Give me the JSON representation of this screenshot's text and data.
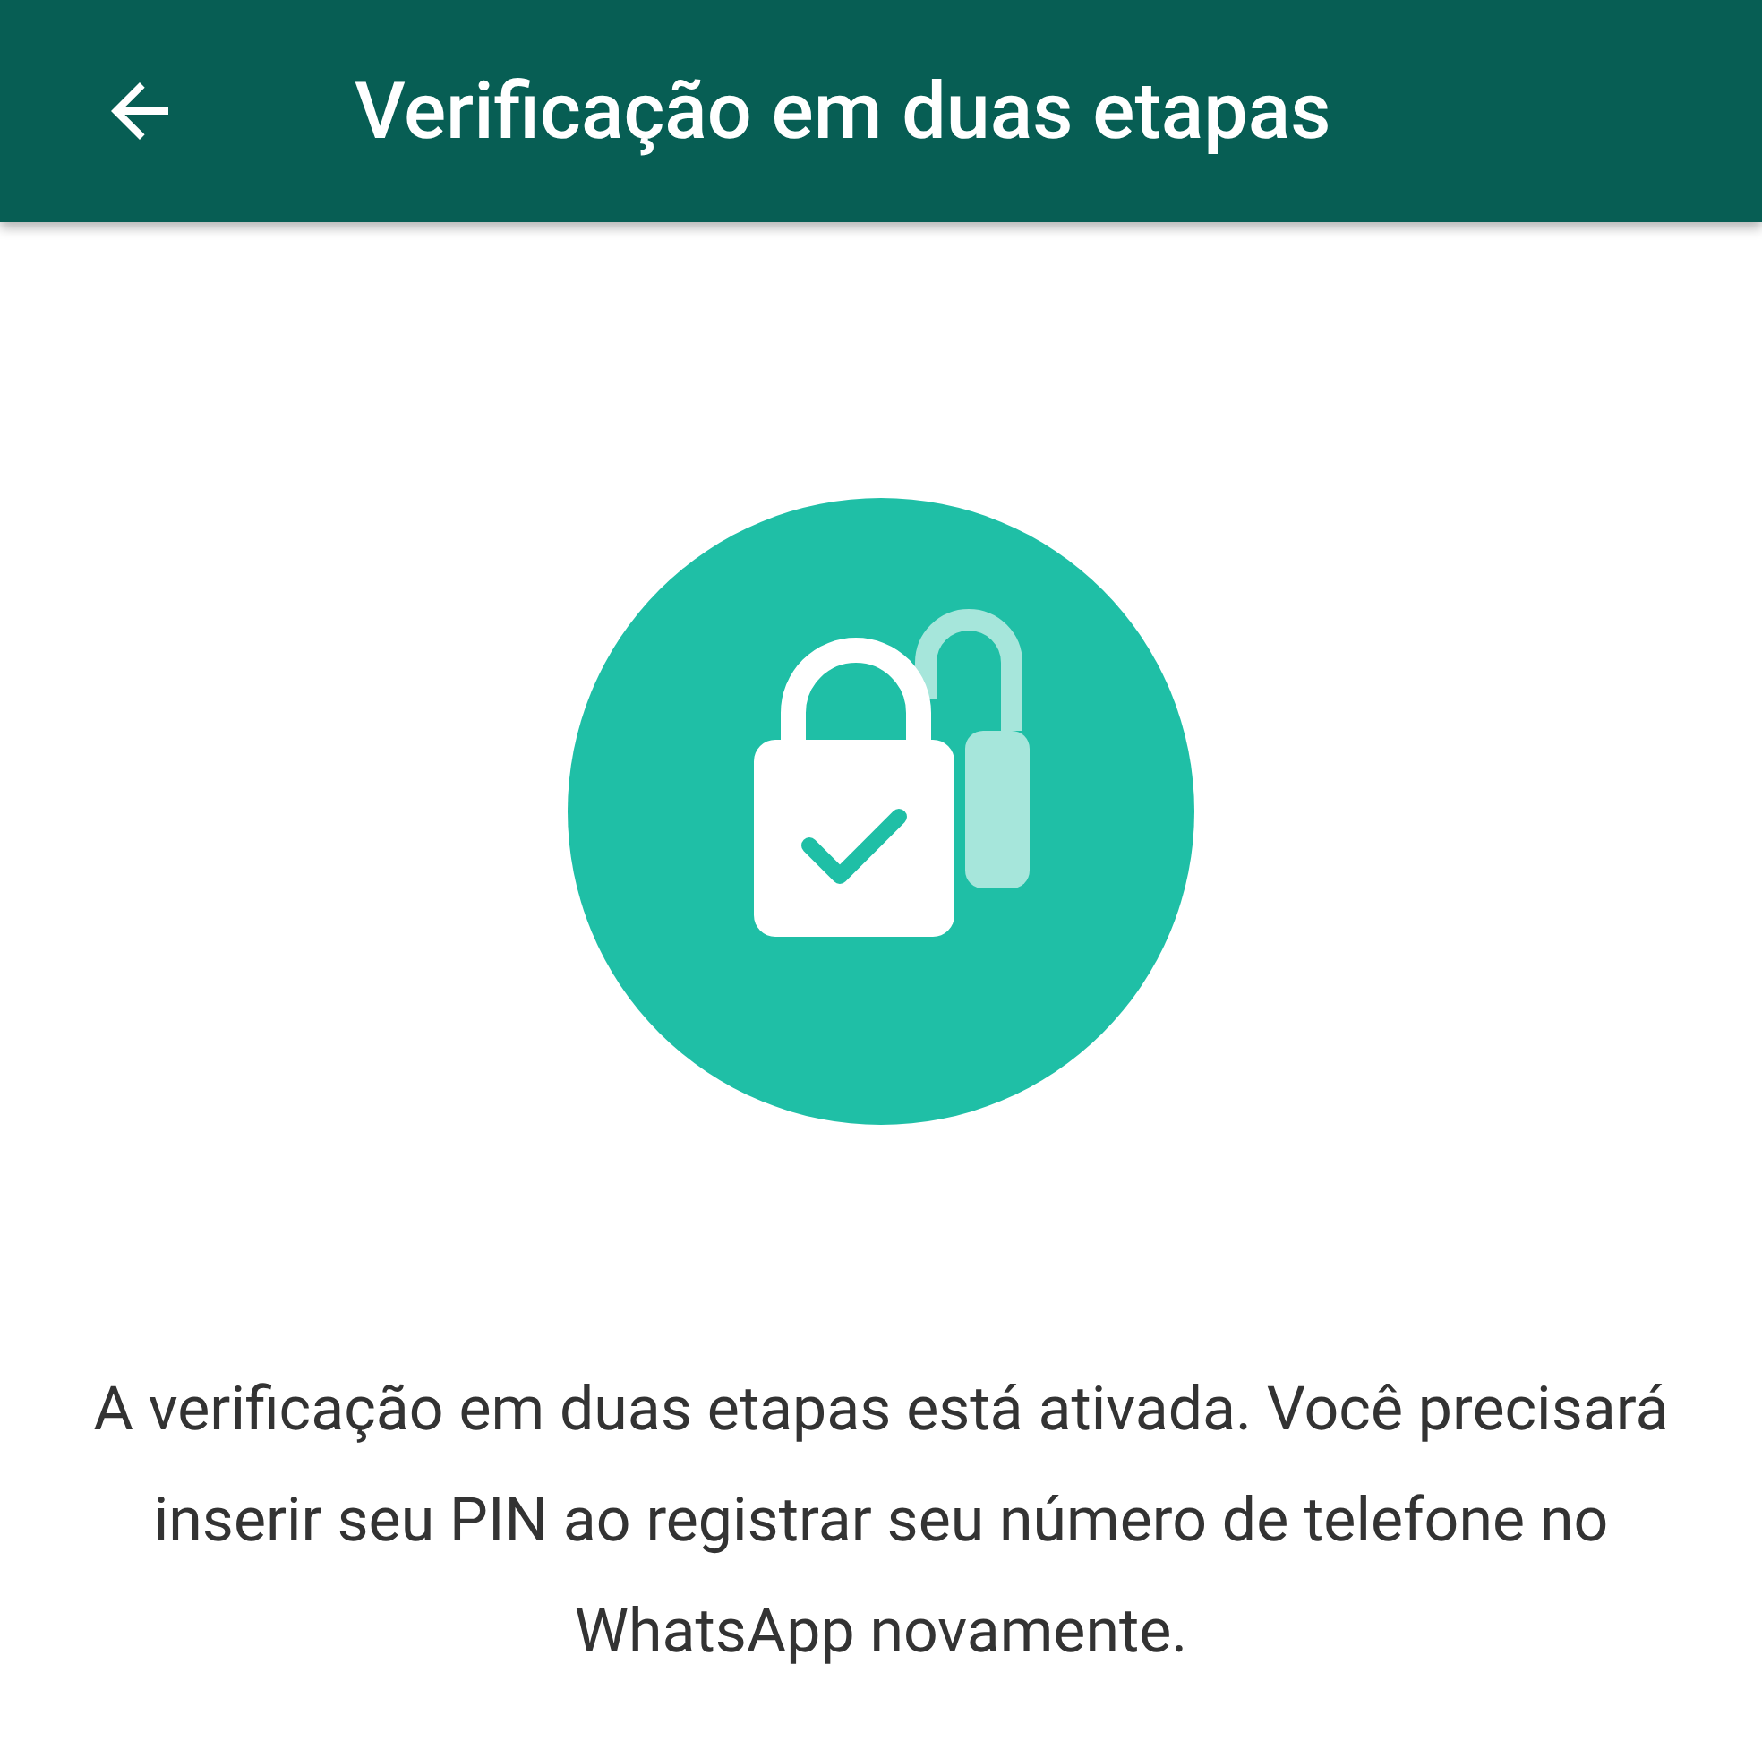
{
  "app_bar": {
    "title": "Verificação em duas etapas"
  },
  "message": "A verificação em duas etapas está ativada. Você precisará inserir seu PIN ao registrar seu número de telefone no WhatsApp novamente."
}
